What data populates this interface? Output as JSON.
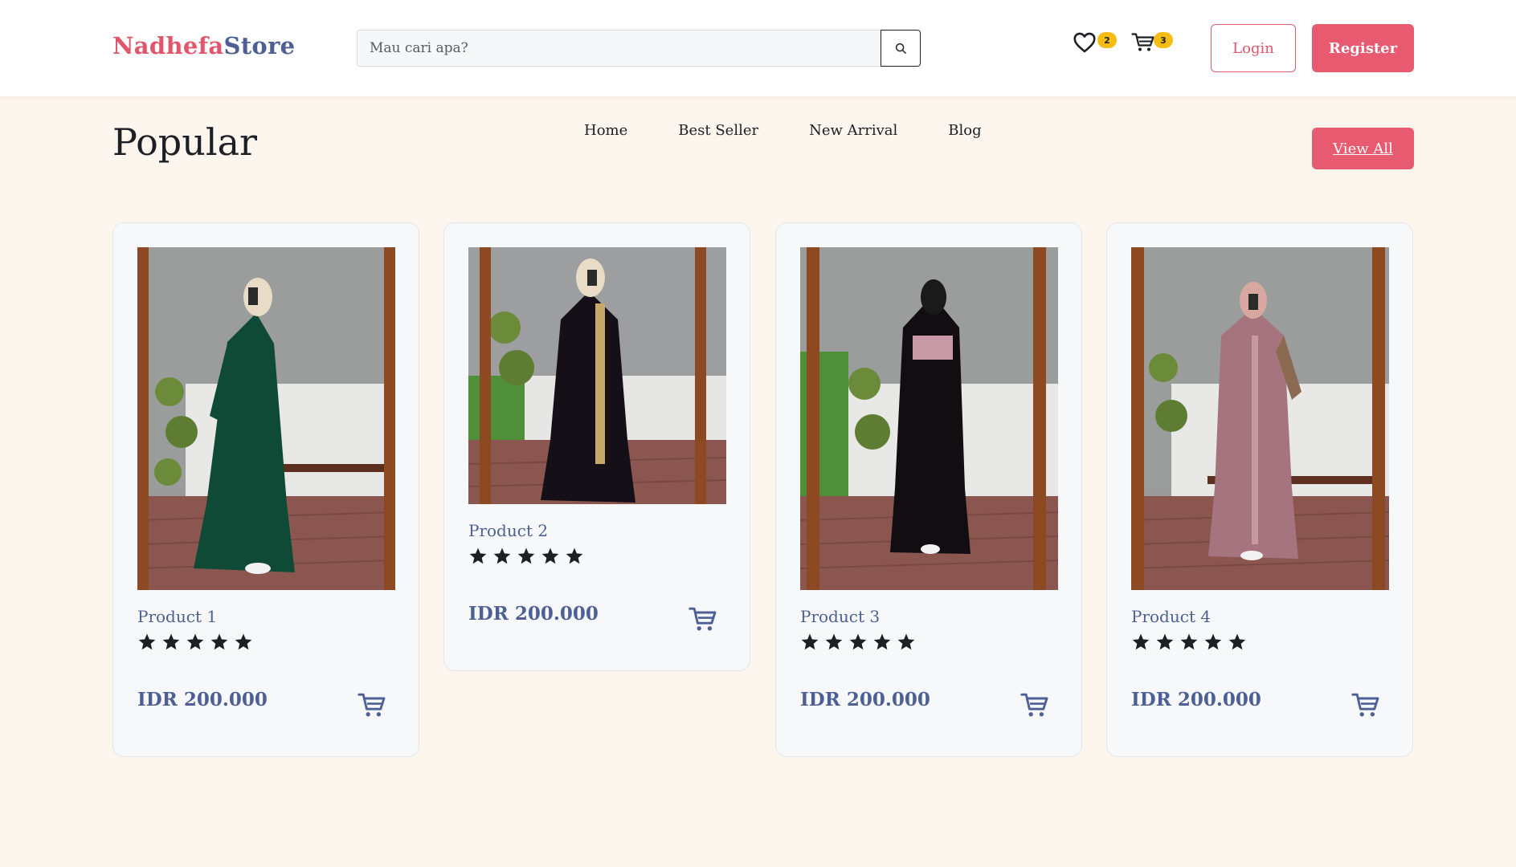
{
  "brand": {
    "part1": "Nadhefa",
    "part2": "Store"
  },
  "search": {
    "placeholder": "Mau cari apa?"
  },
  "wishlist": {
    "count": "2"
  },
  "cart": {
    "count": "3"
  },
  "auth": {
    "login": "Login",
    "register": "Register"
  },
  "section": {
    "title": "Popular",
    "view_all": "View All"
  },
  "nav": [
    "Home",
    "Best Seller",
    "New Arrival",
    "Blog"
  ],
  "products": [
    {
      "name": "Product 1",
      "price": "IDR 200.000",
      "rating": 5,
      "dress_color": "#0e4a36"
    },
    {
      "name": "Product 2",
      "price": "IDR 200.000",
      "rating": 5,
      "dress_color": "#151018"
    },
    {
      "name": "Product 3",
      "price": "IDR 200.000",
      "rating": 5,
      "dress_color": "#120d11"
    },
    {
      "name": "Product 4",
      "price": "IDR 200.000",
      "rating": 5,
      "dress_color": "#a6747f"
    }
  ],
  "colors": {
    "brand_pink": "#e2566c",
    "brand_blue": "#4d5f94",
    "badge": "#f5bd14",
    "page_bg": "#fdf6ee"
  }
}
